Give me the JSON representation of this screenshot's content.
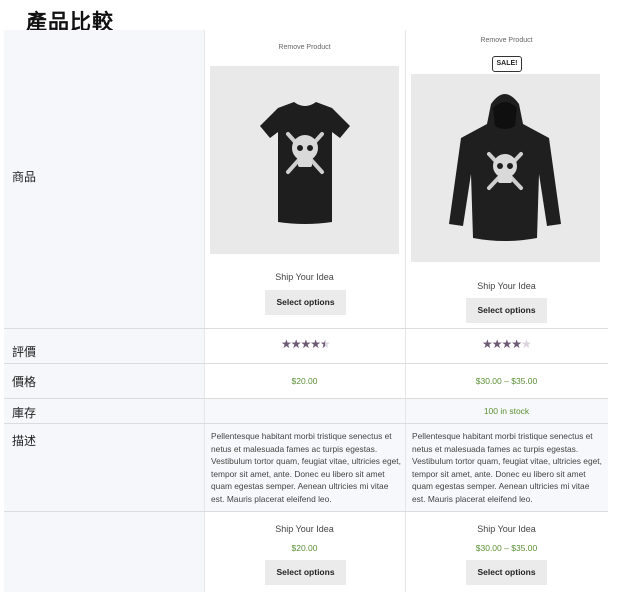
{
  "page_title": "產品比較",
  "row_labels": {
    "product": "商品",
    "rating": "評價",
    "price": "價格",
    "stock": "庫存",
    "description": "描述"
  },
  "products": [
    {
      "remove_label": "Remove Product",
      "sale_badge": "",
      "image_icon": "skull-tshirt-icon",
      "name": "Ship Your Idea",
      "button_label": "Select options",
      "rating": 4.5,
      "price": "$20.00",
      "stock": "",
      "description": "Pellentesque habitant morbi tristique senectus et netus et malesuada fames ac turpis egestas. Vestibulum tortor quam, feugiat vitae, ultricies eget, tempor sit amet, ante. Donec eu libero sit amet quam egestas semper. Aenean ultricies mi vitae est. Mauris placerat eleifend leo.",
      "footer_name": "Ship Your Idea",
      "footer_price": "$20.00",
      "footer_button_label": "Select options"
    },
    {
      "remove_label": "Remove Product",
      "sale_badge": "SALE!",
      "image_icon": "skull-hoodie-icon",
      "name": "Ship Your Idea",
      "button_label": "Select options",
      "rating": 4,
      "price": "$30.00 – $35.00",
      "stock": "100 in stock",
      "description": "Pellentesque habitant morbi tristique senectus et netus et malesuada fames ac turpis egestas. Vestibulum tortor quam, feugiat vitae, ultricies eget, tempor sit amet, ante. Donec eu libero sit amet quam egestas semper. Aenean ultricies mi vitae est. Mauris placerat eleifend leo.",
      "footer_name": "Ship Your Idea",
      "footer_price": "$30.00 – $35.00",
      "footer_button_label": "Select options"
    }
  ],
  "colors": {
    "label_column_bg": "#f6f7fb",
    "price_green": "#5b8f35",
    "star_fill": "#6d5b74",
    "button_bg": "#ebebeb"
  }
}
